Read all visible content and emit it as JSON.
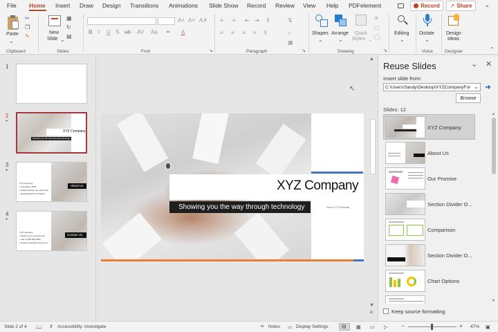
{
  "menu": {
    "tabs": [
      "File",
      "Home",
      "Insert",
      "Draw",
      "Design",
      "Transitions",
      "Animations",
      "Slide Show",
      "Record",
      "Review",
      "View",
      "Help",
      "PDFelement"
    ],
    "active_tab": "Home",
    "record_label": "Record",
    "share_label": "Share"
  },
  "ribbon": {
    "paste": "Paste",
    "new_slide_line1": "New",
    "new_slide_line2": "Slide",
    "shapes": "Shapes",
    "arrange": "Arrange",
    "quick_styles_line1": "Quick",
    "quick_styles_line2": "Styles",
    "editing": "Editing",
    "dictate": "Dictate",
    "design_ideas_line1": "Design",
    "design_ideas_line2": "Ideas",
    "groups": {
      "clipboard": "Clipboard",
      "slides": "Slides",
      "font": "Font",
      "paragraph": "Paragraph",
      "drawing": "Drawing",
      "voice": "Voice",
      "designer": "Designer"
    }
  },
  "thumbnails": {
    "numbers": [
      "1",
      "2",
      "3",
      "4"
    ],
    "star": "*",
    "slide2_title": "XYZ Company",
    "slide2_sub": "Showing you the way through technology",
    "slide3_title": "About Us",
    "slide3_bullets": [
      "XYZ Company",
      "• Founded in 2000",
      "• Award-winning, top-rated tech",
      "• Headquartered in Orlando"
    ],
    "slide4_title": "Contact Us",
    "slide4_bullets": [
      "XYZ Company",
      "• Reach us at company.com",
      "• Call us 555-555-5555",
      "• Email contact@company.com"
    ]
  },
  "slide": {
    "title": "XYZ Company",
    "subtitle": "Showing you the way through technology",
    "footer_text": "Part of XYZ Financial"
  },
  "reuse": {
    "title": "Reuse Slides",
    "insert_from_label": "Insert slide from:",
    "path": "C:\\Users\\Sandy\\Desktop\\XYZCompanyFor",
    "browse": "Browse",
    "count": "Slides: 12",
    "slides": [
      "XYZ Company",
      "About Us",
      "Our Promise",
      "Section Divider O...",
      "Comparison",
      "Section Divider O...",
      "Chart Options"
    ],
    "keep_formatting": "Keep source formatting"
  },
  "status": {
    "slide_of": "Slide 2 of 4",
    "accessibility": "Accessibility: Investigate",
    "notes": "Notes",
    "display_settings": "Display Settings",
    "zoom": "47%"
  },
  "colors": {
    "accent": "#b7472a",
    "selected_thumb_border": "#a4373a",
    "slide_blue_bar": "#4472c4",
    "slide_orange_bar": "#ed7d31"
  }
}
